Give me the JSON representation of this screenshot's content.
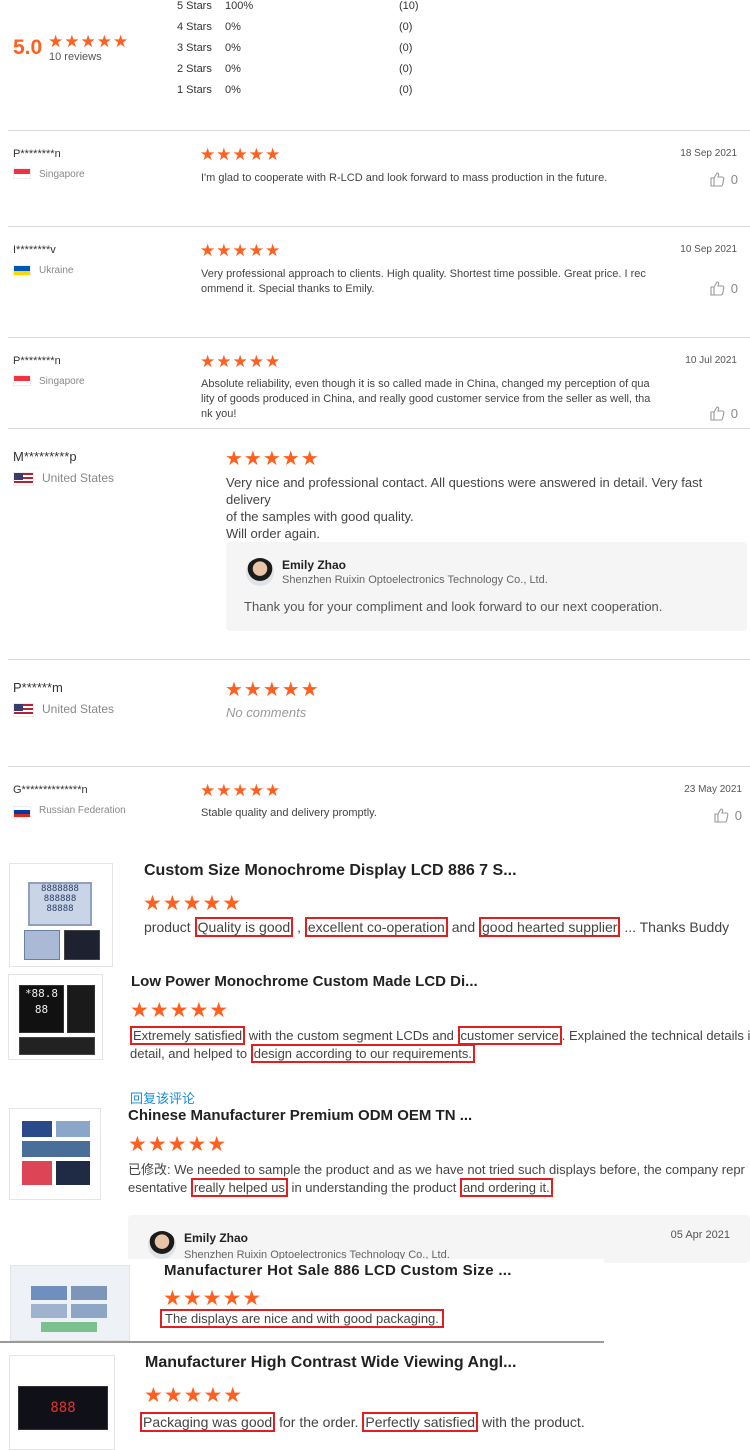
{
  "summary": {
    "score": "5.0",
    "reviews": "10 reviews",
    "rows": [
      {
        "label": "5 Stars",
        "pct": "100%",
        "count": "(10)"
      },
      {
        "label": "4 Stars",
        "pct": "0%",
        "count": "(0)"
      },
      {
        "label": "3 Stars",
        "pct": "0%",
        "count": "(0)"
      },
      {
        "label": "2 Stars",
        "pct": "0%",
        "count": "(0)"
      },
      {
        "label": "1 Stars",
        "pct": "0%",
        "count": "(0)"
      }
    ]
  },
  "reviews": [
    {
      "user": "P********n",
      "country": "Singapore",
      "date": "18 Sep 2021",
      "text": "I'm glad to cooperate with R-LCD and look forward to mass production in the future.",
      "likes": "0"
    },
    {
      "user": "I********v",
      "country": "Ukraine",
      "date": "10 Sep 2021",
      "text1": "Very professional approach to clients. High quality. Shortest time possible. Great price. I rec",
      "text2": "ommend it. Special thanks to Emily.",
      "likes": "0"
    },
    {
      "user": "P********n",
      "country": "Singapore",
      "date": "10 Jul 2021",
      "text1": "Absolute reliability, even though it is so called made in China, changed my perception of qua",
      "text2": "lity of goods produced in China, and really good customer service from the seller as well, tha",
      "text3": "nk you!",
      "likes": "0"
    },
    {
      "user": "M*********p",
      "country": "United States",
      "text1": "Very nice and professional contact. All questions were answered in detail. Very fast delivery",
      "text2": "of the samples with good quality.",
      "text3": "Will order again.",
      "reply": {
        "name": "Emily Zhao",
        "company": "Shenzhen Ruixin Optoelectronics Technology Co., Ltd.",
        "text": "Thank you for your compliment and look forward to our next cooperation."
      }
    },
    {
      "user": "P******m",
      "country": "United States",
      "text": "No comments"
    },
    {
      "user": "G**************n",
      "country": "Russian Federation",
      "date": "23 May 2021",
      "text": "Stable quality and delivery promptly.",
      "likes": "0"
    }
  ],
  "products": [
    {
      "title": "Custom Size Monochrome Display LCD 886 7 S...",
      "t1": "product ",
      "h1": "Quality is good",
      "t2": " , ",
      "h2": "excellent co-operation",
      "t3": " and ",
      "h3": "good hearted supplier",
      "t4": " ... Thanks Buddy"
    },
    {
      "title": "Low Power Monochrome Custom Made LCD Di...",
      "h1": "Extremely satisfied",
      "t1": " with the custom segment LCDs and ",
      "h2": "customer service",
      "t2": ". Explained the technical details in",
      "t3": "detail, and helped to ",
      "h3": "design according to our requirements."
    },
    {
      "reply_link": "回复该评论",
      "title": "Chinese Manufacturer Premium ODM OEM TN ...",
      "t1": "已修改: We needed to sample the product and as we have not tried such displays before, the company repr",
      "t2": "esentative ",
      "h1": "really helped us",
      "t3": " in understanding the product ",
      "h2": "and ordering it."
    },
    {
      "reply_name": "Emily Zhao",
      "reply_company": "Shenzhen Ruixin Optoelectronics Technology Co., Ltd.",
      "reply_date": "05 Apr 2021",
      "title": "Manufacturer Hot Sale 886 LCD Custom Size ...",
      "h1": "The displays are nice and with good packaging."
    },
    {
      "title": "Manufacturer High Contrast Wide Viewing Angl...",
      "h1": "Packaging was good",
      "t1": " for the order. ",
      "h2": "Perfectly satisfied",
      "t2": " with the product."
    }
  ],
  "stars": "★★★★★",
  "colors": {
    "star": "#ff5f1f",
    "highlight": "#e02020",
    "link": "#1a8cd8"
  }
}
